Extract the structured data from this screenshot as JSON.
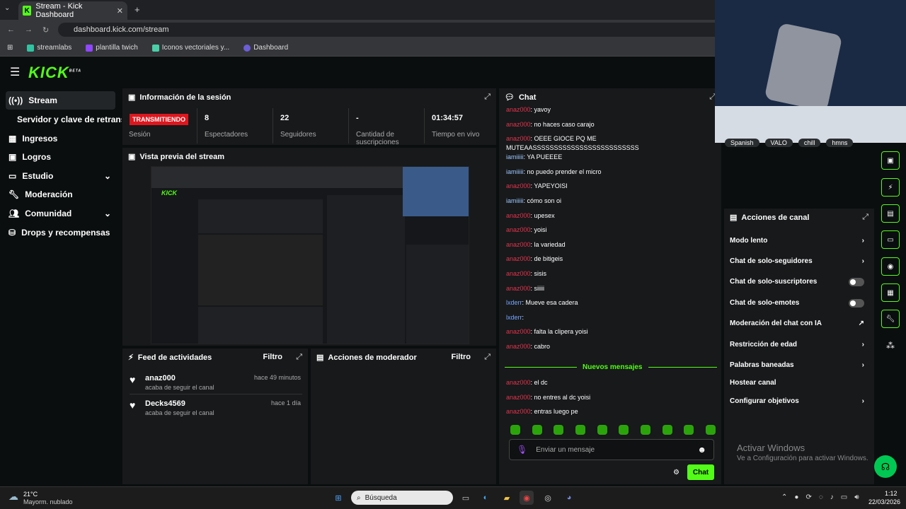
{
  "browser": {
    "tab_title": "Stream - Kick Dashboard",
    "url": "dashboard.kick.com/stream",
    "bookmarks": [
      "streamlabs",
      "plantilla twich",
      "Iconos vectoriales y...",
      "Dashboard"
    ]
  },
  "app": {
    "logo": "KICK",
    "beta": "BETA"
  },
  "sidebar": {
    "items": [
      "Stream",
      "Servidor y clave de retransmisión",
      "Ingresos",
      "Logros",
      "Estudio",
      "Moderación",
      "Comunidad",
      "Drops y recompensas"
    ]
  },
  "session": {
    "title": "Información de la sesión",
    "status": "TRANSMITIENDO",
    "status_label": "Sesión",
    "stats": [
      {
        "value": "8",
        "label": "Espectadores"
      },
      {
        "value": "22",
        "label": "Seguidores"
      },
      {
        "value": "-",
        "label": "Cantidad de suscripciones"
      },
      {
        "value": "01:34:57",
        "label": "Tiempo en vivo"
      }
    ]
  },
  "preview": {
    "title": "Vista previa del stream"
  },
  "activity": {
    "title": "Feed de actividades",
    "filter": "Filtro",
    "items": [
      {
        "user": "anaz000",
        "desc": "acaba de seguir el canal",
        "time": "hace 49 minutos"
      },
      {
        "user": "Decks4569",
        "desc": "acaba de seguir el canal",
        "time": "hace 1 día"
      }
    ]
  },
  "mod_actions": {
    "title": "Acciones de moderador",
    "filter": "Filtro"
  },
  "chat": {
    "title": "Chat",
    "new_messages": "Nuevos mensajes",
    "placeholder": "Enviar un mensaje",
    "send": "Chat",
    "messages": [
      {
        "user": "anaz000",
        "text": ": yavoy",
        "c": "u1"
      },
      {
        "user": "anaz000",
        "text": ": no haces caso carajo",
        "c": "u1"
      },
      {
        "user": "anaz000",
        "text": ": OEEE GIOCE PQ ME",
        "c": "u1"
      },
      {
        "user": "",
        "text": "MUTEAASSSSSSSSSSSSSSSSSSSSSSSSS",
        "c": "u1"
      },
      {
        "user": "iamiiiii",
        "text": ": YA PUEEEE",
        "c": "u2"
      },
      {
        "user": "iamiiiii",
        "text": ": no puedo prender el micro",
        "c": "u2"
      },
      {
        "user": "anaz000",
        "text": ": YAPEYOISI",
        "c": "u1"
      },
      {
        "user": "iamiiiii",
        "text": ": cómo son oi",
        "c": "u2"
      },
      {
        "user": "anaz000",
        "text": ": upesex",
        "c": "u1"
      },
      {
        "user": "anaz000",
        "text": ": yoisi",
        "c": "u1"
      },
      {
        "user": "anaz000",
        "text": ": la variedad",
        "c": "u1"
      },
      {
        "user": "anaz000",
        "text": ": de bitigeis",
        "c": "u1"
      },
      {
        "user": "anaz000",
        "text": ": sisis",
        "c": "u1"
      },
      {
        "user": "anaz000",
        "text": ": siiiii",
        "c": "u1"
      },
      {
        "user": "lxderr",
        "text": ": Mueve esa cadera",
        "c": "u3"
      },
      {
        "user": "lxderr",
        "text": ":",
        "c": "u3"
      },
      {
        "user": "anaz000",
        "text": ": falta la clipera yoisi",
        "c": "u1"
      },
      {
        "user": "anaz000",
        "text": ": cabro",
        "c": "u1"
      }
    ],
    "after": [
      {
        "user": "anaz000",
        "text": ": el dc",
        "c": "u1"
      },
      {
        "user": "anaz000",
        "text": ": no entres al dc yoisi",
        "c": "u1"
      },
      {
        "user": "anaz000",
        "text": ": entras luego pe",
        "c": "u1"
      }
    ]
  },
  "tags": [
    "Spanish",
    "VALO",
    "chill",
    "hmns"
  ],
  "channel_actions": {
    "title": "Acciones de canal",
    "items": [
      "Modo lento",
      "Chat de solo-seguidores",
      "Chat de solo-suscriptores",
      "Chat de solo-emotes",
      "Moderación del chat con IA",
      "Restricción de edad",
      "Palabras baneadas",
      "Hostear canal",
      "Configurar objetivos"
    ]
  },
  "watermark": {
    "line1": "Activar Windows",
    "line2": "Ve a Configuración para activar Windows."
  },
  "taskbar": {
    "weather_temp": "21°C",
    "weather_desc": "Mayorm. nublado",
    "search": "Búsqueda",
    "time": "1:12",
    "date": "22/03/2026"
  },
  "colors": {
    "accent": "#53fc18",
    "live": "#e0161e"
  }
}
